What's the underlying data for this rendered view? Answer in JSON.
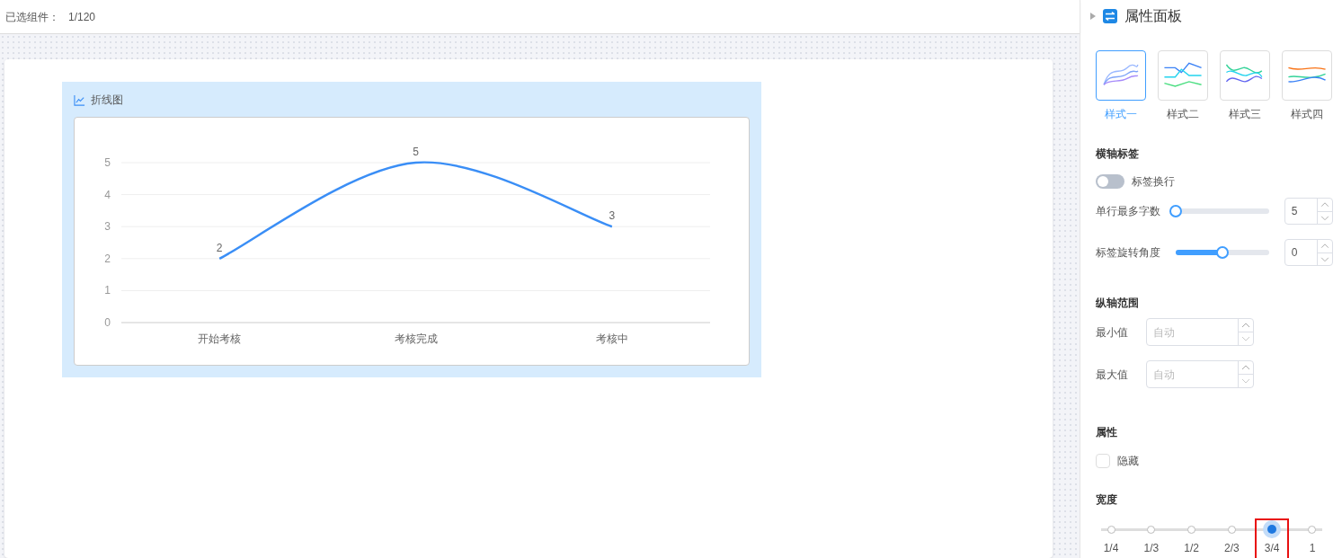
{
  "header": {
    "label": "已选组件：",
    "count": "1/120"
  },
  "widget": {
    "title": "折线图",
    "chart_data": {
      "type": "line",
      "categories": [
        "开始考核",
        "考核完成",
        "考核中"
      ],
      "series": [
        {
          "color": "#3a8ef6",
          "values": [
            2,
            5,
            3
          ]
        }
      ],
      "grid": true,
      "ylim": [
        0,
        5
      ],
      "yticks": [
        0,
        1,
        2,
        3,
        4,
        5
      ],
      "data_labels": true
    }
  },
  "panel": {
    "title": "属性面板",
    "styles": [
      {
        "label": "样式一",
        "selected": true
      },
      {
        "label": "样式二",
        "selected": false
      },
      {
        "label": "样式三",
        "selected": false
      },
      {
        "label": "样式四",
        "selected": false
      }
    ],
    "x_axis": {
      "heading": "横轴标签",
      "wrap": {
        "label": "标签换行",
        "on": false
      },
      "sliders": [
        {
          "label": "单行最多字数",
          "level": 0,
          "value": "5"
        },
        {
          "label": "标签旋转角度",
          "level": 0.5,
          "value": "0"
        }
      ]
    },
    "y_axis": {
      "heading": "纵轴范围",
      "fields": [
        {
          "label": "最小值",
          "placeholder": "自动"
        },
        {
          "label": "最大值",
          "placeholder": "自动"
        }
      ]
    },
    "attributes": {
      "heading": "属性",
      "hidden": {
        "label": "隐藏",
        "checked": false
      }
    },
    "width": {
      "heading": "宽度",
      "options": [
        {
          "label": "1/4",
          "selected": false,
          "highlighted": false
        },
        {
          "label": "1/3",
          "selected": false,
          "highlighted": false
        },
        {
          "label": "1/2",
          "selected": false,
          "highlighted": false
        },
        {
          "label": "2/3",
          "selected": false,
          "highlighted": false
        },
        {
          "label": "3/4",
          "selected": true,
          "highlighted": true
        },
        {
          "label": "1",
          "selected": false,
          "highlighted": false
        }
      ]
    }
  }
}
